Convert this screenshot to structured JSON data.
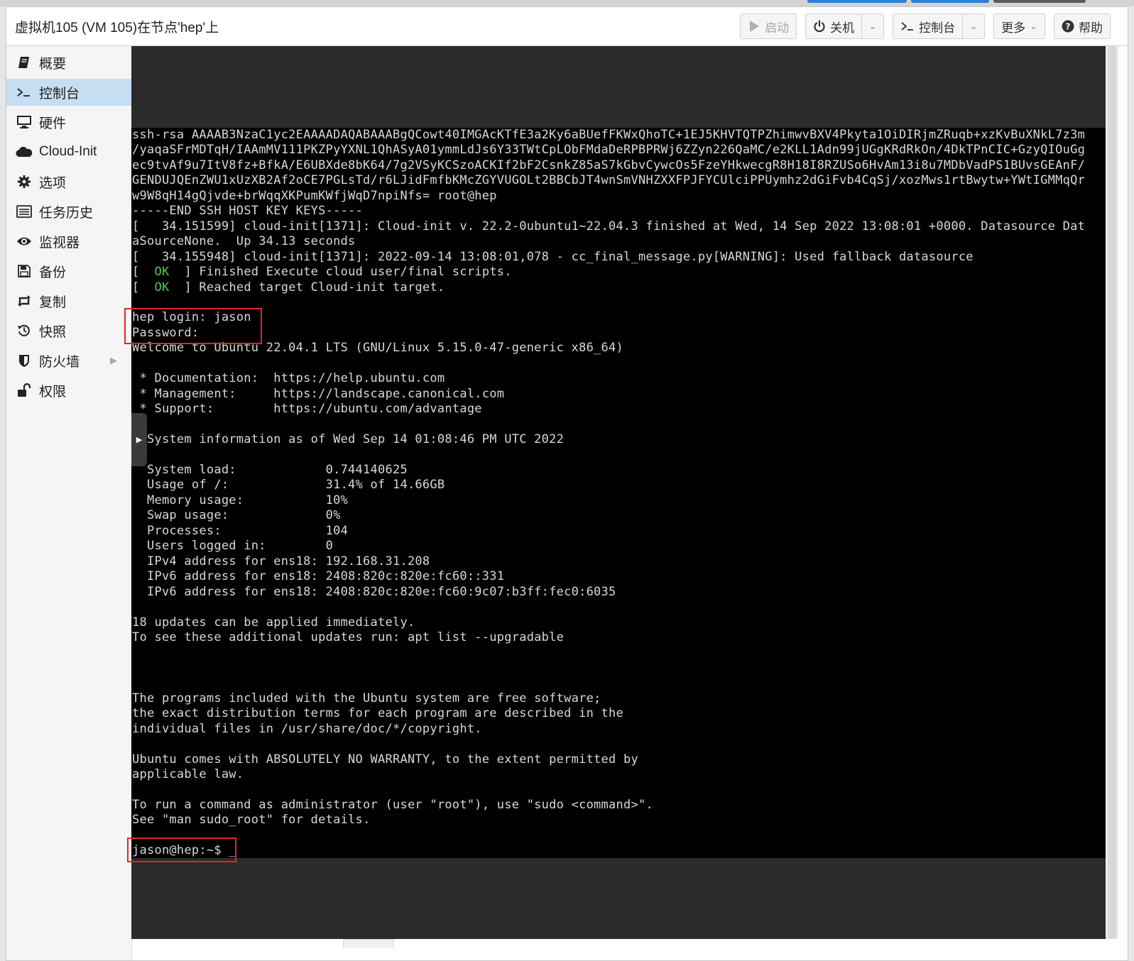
{
  "window": {
    "title": "虚拟机105 (VM 105)在节点'hep'上"
  },
  "toolbar": {
    "start_label": "启动",
    "shutdown_label": "关机",
    "console_label": "控制台",
    "more_label": "更多",
    "help_label": "帮助"
  },
  "sidebar": {
    "items": [
      {
        "label": "概要",
        "icon": "book-icon"
      },
      {
        "label": "控制台",
        "icon": "terminal-icon",
        "active": true
      },
      {
        "label": "硬件",
        "icon": "monitor-icon"
      },
      {
        "label": "Cloud-Init",
        "icon": "cloud-icon"
      },
      {
        "label": "选项",
        "icon": "gear-icon"
      },
      {
        "label": "任务历史",
        "icon": "list-icon"
      },
      {
        "label": "监视器",
        "icon": "eye-icon"
      },
      {
        "label": "备份",
        "icon": "floppy-icon"
      },
      {
        "label": "复制",
        "icon": "retweet-icon"
      },
      {
        "label": "快照",
        "icon": "history-icon"
      },
      {
        "label": "防火墙",
        "icon": "shield-icon"
      },
      {
        "label": "权限",
        "icon": "unlock-icon"
      }
    ]
  },
  "terminal": {
    "lines": [
      "ssh-rsa AAAAB3NzaC1yc2EAAAADAQABAAABgQCowt40IMGAcKTfE3a2Ky6aBUefFKWxQhoTC+1EJ5KHVTQTPZhimwvBXV4Pkyta1OiDIRjmZRuqb+xzKvBuXNkL7z3m",
      "/yaqaSFrMDTqH/IAAmMV111PKZPyYXNL1QhASyA01ymmLdJs6Y33TWtCpLObFMdaDeRPBPRWj6ZZyn226QaMC/e2KLL1Adn99jUGgKRdRkOn/4DkTPnCIC+GzyQIOuGg",
      "ec9tvAf9u7ItV8fz+BfkA/E6UBXde8bK64/7g2VSyKCSzoACKIf2bF2CsnkZ85aS7kGbvCywcOs5FzeYHkwecgR8H18I8RZUSo6HvAm13i8u7MDbVadPS1BUvsGEAnF/",
      "GENDUJQEnZWU1xUzXB2Af2oCE7PGLsTd/r6LJidFmfbKMcZGYVUGOLt2BBCbJT4wnSmVNHZXXFPJFYCUlciPPUymhz2dGiFvb4CqSj/xozMws1rtBwytw+YWtIGMMqQr",
      "w9W8qH14gQjvde+brWqqXKPumKWfjWqD7npiNfs= root@hep",
      "-----END SSH HOST KEY KEYS-----",
      "[   34.151599] cloud-init[1371]: Cloud-init v. 22.2-0ubuntu1~22.04.3 finished at Wed, 14 Sep 2022 13:08:01 +0000. Datasource Dat",
      "aSourceNone.  Up 34.13 seconds",
      "[   34.155948] cloud-init[1371]: 2022-09-14 13:08:01,078 - cc_final_message.py[WARNING]: Used fallback datasource"
    ],
    "ok_text": "OK",
    "ok_lines": [
      "] Finished Execute cloud user/final scripts.",
      "] Reached target Cloud-init target."
    ],
    "lines2": [
      "",
      "hep login: jason",
      "Password:",
      "Welcome to Ubuntu 22.04.1 LTS (GNU/Linux 5.15.0-47-generic x86_64)",
      "",
      " * Documentation:  https://help.ubuntu.com",
      " * Management:     https://landscape.canonical.com",
      " * Support:        https://ubuntu.com/advantage",
      "",
      "  System information as of Wed Sep 14 01:08:46 PM UTC 2022",
      "",
      "  System load:            0.744140625",
      "  Usage of /:             31.4% of 14.66GB",
      "  Memory usage:           10%",
      "  Swap usage:             0%",
      "  Processes:              104",
      "  Users logged in:        0",
      "  IPv4 address for ens18: 192.168.31.208",
      "  IPv6 address for ens18: 2408:820c:820e:fc60::331",
      "  IPv6 address for ens18: 2408:820c:820e:fc60:9c07:b3ff:fec0:6035",
      "",
      "18 updates can be applied immediately.",
      "To see these additional updates run: apt list --upgradable",
      "",
      "",
      "",
      "The programs included with the Ubuntu system are free software;",
      "the exact distribution terms for each program are described in the",
      "individual files in /usr/share/doc/*/copyright.",
      "",
      "Ubuntu comes with ABSOLUTELY NO WARRANTY, to the extent permitted by",
      "applicable law.",
      "",
      "To run a command as administrator (user \"root\"), use \"sudo <command>\".",
      "See \"man sudo_root\" for details.",
      "",
      "jason@hep:~$ _"
    ]
  }
}
